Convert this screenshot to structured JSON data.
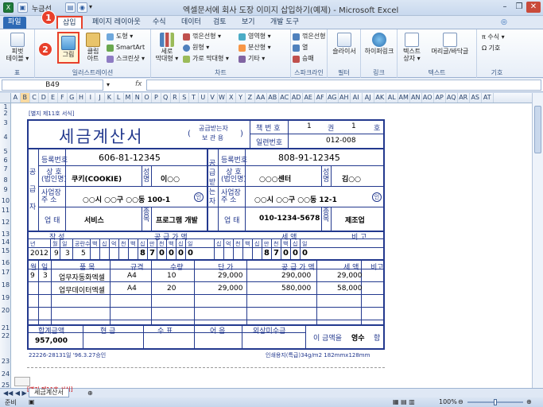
{
  "window": {
    "title": "엑셀문서에 회사 도장 이미지 삽입하기(예제) - Microsoft Excel",
    "quick_access": "누금선"
  },
  "tabs": [
    {
      "label": "파일"
    },
    {
      "label": "삽입"
    },
    {
      "label": "페이지 레이아웃"
    },
    {
      "label": "수식"
    },
    {
      "label": "데이터"
    },
    {
      "label": "검토"
    },
    {
      "label": "보기"
    },
    {
      "label": "개발 도구"
    }
  ],
  "ribbon": {
    "table": {
      "pivot": "피벗\n테이블 ▾",
      "label": "표"
    },
    "illustration": {
      "picture": "그림",
      "clipart": "클립\n아트",
      "shapes": "도형 ▾",
      "smartart": "SmartArt",
      "screenshot": "스크린샷 ▾",
      "label": "일러스트레이션"
    },
    "charts": {
      "column": "세로\n막대형 ▾",
      "line": "꺾은선형 ▾",
      "pie": "원형 ▾",
      "bar": "가로 막대형 ▾",
      "area": "영역형 ▾",
      "scatter": "분산형 ▾",
      "other": "기타 ▾",
      "label": "차트"
    },
    "sparklines": {
      "line": "꺾은선형",
      "column": "열",
      "winloss": "승패",
      "label": "스파크라인"
    },
    "filter": {
      "slicer": "슬라이서",
      "label": "필터"
    },
    "links": {
      "hyperlink": "하이퍼링크",
      "label": "링크"
    },
    "text": {
      "textbox": "텍스트\n상자 ▾",
      "headerfooter": "머리글/바닥글",
      "label": "텍스트"
    },
    "symbols": {
      "equation": "π 수식 ▾",
      "symbol": "Ω 기호",
      "label": "기호"
    },
    "badges": [
      "1",
      "2"
    ]
  },
  "formula": {
    "namebox": "B49",
    "fx": "fx"
  },
  "columns": [
    "A",
    "B",
    "C",
    "D",
    "E",
    "F",
    "G",
    "H",
    "I",
    "J",
    "K",
    "L",
    "M",
    "N",
    "O",
    "P",
    "Q",
    "R",
    "S",
    "T",
    "U",
    "V",
    "W",
    "X",
    "Y",
    "Z",
    "AA",
    "AB",
    "AC",
    "AD",
    "AE",
    "AF",
    "AG",
    "AH",
    "AI",
    "AJ",
    "AK",
    "AL",
    "AM",
    "AN",
    "AO",
    "AP",
    "AQ",
    "AR",
    "AS",
    "AT"
  ],
  "rows": [
    "1",
    "2",
    "3",
    "4",
    "5",
    "6",
    "7",
    "8",
    "9",
    "10",
    "11",
    "12",
    "13",
    "14",
    "15",
    "16",
    "17",
    "18",
    "19",
    "20",
    "21",
    "22",
    "23",
    "24",
    "25"
  ],
  "invoice": {
    "form_no": "[별지 제11호 서식]",
    "title": "세금계산서",
    "receiver_label": "공급받는자",
    "keep_label": "보 관 용",
    "paren_l": "(",
    "paren_r": ")",
    "book_no": "책 번 호",
    "book_val": "1",
    "book_unit": "권",
    "book_val2": "1",
    "book_unit2": "호",
    "serial": "일련번호",
    "serial_val": "012-008",
    "supplier_side": "공급자",
    "receiver_side": "공급받는자",
    "reg_no": "등록번호",
    "supplier_reg": "606-81-12345",
    "receiver_reg": "808-91-12345",
    "company": "상 호\n(법인명)",
    "name_label": "성명",
    "supplier_company": "쿠키(COOKIE)",
    "supplier_name": "이○○",
    "receiver_company": "○○○센터",
    "receiver_name": "김○○",
    "address": "사업장\n주 소",
    "supplier_addr": "○○시 ○○구 ○○동 100-1",
    "receiver_addr": "○○시 ○○구 ○○동 12-1",
    "stamp": "인",
    "biz": "업 태",
    "item_label": "종목",
    "supplier_biz": "서비스",
    "supplier_item": "프로그램 개발",
    "receiver_biz": "010-1234-5678",
    "receiver_item": "제조업",
    "sec_written": "작 성",
    "sec_supply": "공 급 가 액",
    "sec_tax": "세 액",
    "sec_note": "비 고",
    "date_heads": [
      "년",
      "월",
      "일",
      "공란수",
      "백",
      "십",
      "억",
      "천",
      "백",
      "십",
      "만",
      "천",
      "백",
      "십",
      "일",
      "십",
      "억",
      "천",
      "백",
      "십",
      "만",
      "천",
      "백",
      "십",
      "일"
    ],
    "date_year": "2012",
    "date_month": "9",
    "date_day": "3",
    "blank_cnt": "5",
    "supply_digits": [
      "8",
      "7",
      "0",
      "0",
      "0",
      "0"
    ],
    "tax_digits": [
      "8",
      "7",
      "0",
      "0",
      "0"
    ],
    "item_heads": [
      "월",
      "일",
      "품 목",
      "규격",
      "수량",
      "단 가",
      "공 급 가 액",
      "세 액",
      "비고"
    ],
    "items": [
      {
        "m": "9",
        "d": "3",
        "name": "업무자동화엑셀",
        "spec": "A4",
        "qty": "10",
        "price": "29,000",
        "supply": "290,000",
        "tax": "29,000"
      },
      {
        "m": "",
        "d": "",
        "name": "업무데이터엑셀",
        "spec": "A4",
        "qty": "20",
        "price": "29,000",
        "supply": "580,000",
        "tax": "58,000"
      }
    ],
    "total_heads": [
      "합계금액",
      "현 금",
      "수 표",
      "어 음",
      "외상미수금"
    ],
    "total_val": "957,000",
    "receipt_pre": "이 금액을",
    "receipt_mid": "영수",
    "receipt_post": "함",
    "footer_l": "22226-28131일 '96.3.27승인",
    "footer_r": "인쇄용지(특급)34g/m2 182mmx128mm"
  },
  "sheet": {
    "tab": "세금계산서",
    "tab_hint": "[별지 제11호 서식]"
  },
  "status": {
    "ready": "준비",
    "zoom": "100%"
  },
  "colors": {
    "accent": "#2e6ab5",
    "form": "#23398e",
    "highlight": "#e8402b"
  }
}
